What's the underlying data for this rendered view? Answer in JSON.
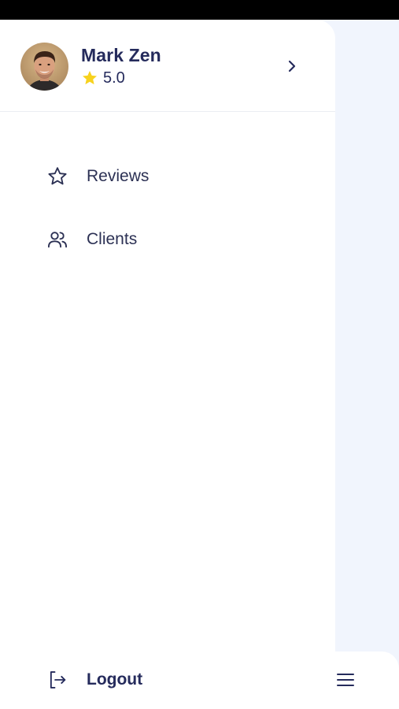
{
  "profile": {
    "name": "Mark Zen",
    "rating": "5.0",
    "star_color": "#f7d21e",
    "avatar_icon": "avatar"
  },
  "menu": {
    "items": [
      {
        "label": "Reviews",
        "icon": "star-icon"
      },
      {
        "label": "Clients",
        "icon": "users-icon"
      }
    ],
    "logout_label": "Logout"
  },
  "colors": {
    "text_primary": "#252b5c",
    "drawer_bg": "#ffffff",
    "content_bg": "#f1f5fd"
  }
}
